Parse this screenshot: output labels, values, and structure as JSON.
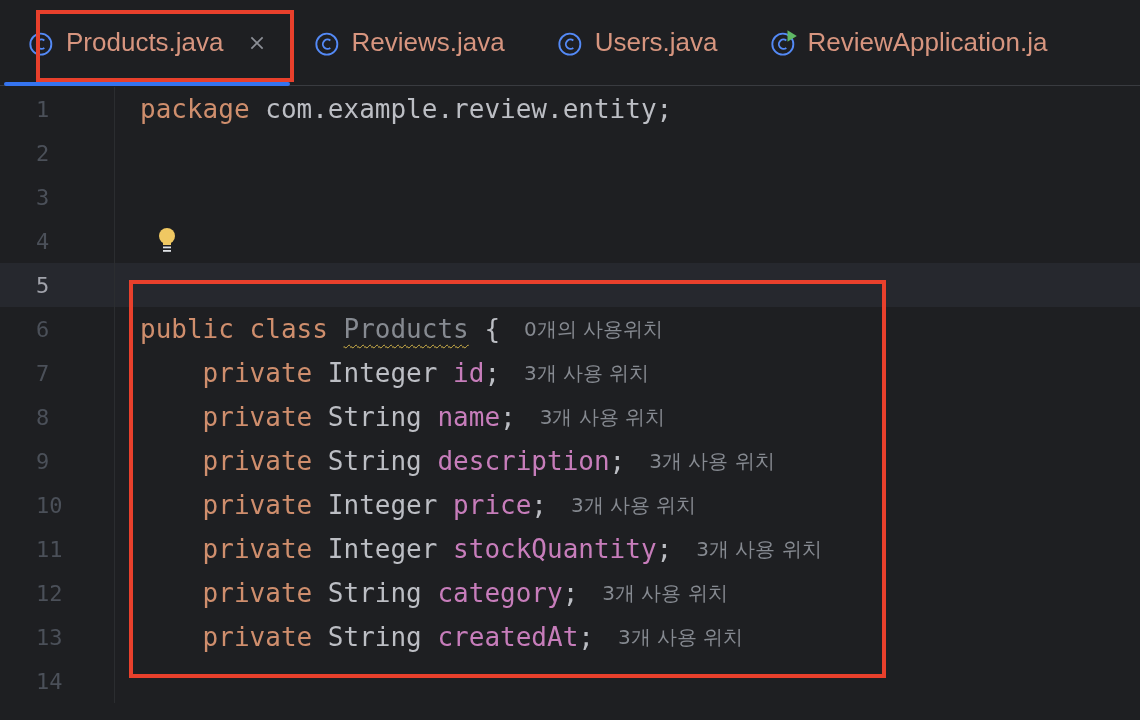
{
  "tabs": [
    {
      "label": "Products.java",
      "kind": "class",
      "selected": true
    },
    {
      "label": "Reviews.java",
      "kind": "class",
      "selected": false
    },
    {
      "label": "Users.java",
      "kind": "class",
      "selected": false
    },
    {
      "label": "ReviewApplication.ja",
      "kind": "app",
      "selected": false
    }
  ],
  "lines": [
    {
      "number": "1",
      "current": false,
      "bulb": false,
      "tokens": [
        {
          "kind": "keyword",
          "text": "package"
        },
        {
          "kind": "plain",
          "text": " com.example.review.entity;"
        }
      ]
    },
    {
      "number": "2",
      "current": false,
      "bulb": false
    },
    {
      "number": "3",
      "current": false,
      "bulb": false
    },
    {
      "number": "4",
      "current": false,
      "bulb": true
    },
    {
      "number": "5",
      "current": true,
      "bulb": false
    },
    {
      "number": "6",
      "current": false,
      "bulb": false,
      "tokens": [
        {
          "kind": "keyword",
          "text": "public class "
        },
        {
          "kind": "unused",
          "text": "Products"
        },
        {
          "kind": "plain",
          "text": " {"
        }
      ],
      "hint": "0개의 사용위치"
    },
    {
      "number": "7",
      "current": false,
      "bulb": false,
      "tokens": [
        {
          "kind": "keyword",
          "text": "    private "
        },
        {
          "kind": "plain",
          "text": "Integer "
        },
        {
          "kind": "field",
          "text": "id"
        },
        {
          "kind": "plain",
          "text": ";"
        }
      ],
      "hint": "3개 사용 위치"
    },
    {
      "number": "8",
      "current": false,
      "bulb": false,
      "tokens": [
        {
          "kind": "keyword",
          "text": "    private "
        },
        {
          "kind": "plain",
          "text": "String "
        },
        {
          "kind": "field",
          "text": "name"
        },
        {
          "kind": "plain",
          "text": ";"
        }
      ],
      "hint": "3개 사용 위치"
    },
    {
      "number": "9",
      "current": false,
      "bulb": false,
      "tokens": [
        {
          "kind": "keyword",
          "text": "    private "
        },
        {
          "kind": "plain",
          "text": "String "
        },
        {
          "kind": "field",
          "text": "description"
        },
        {
          "kind": "plain",
          "text": ";"
        }
      ],
      "hint": "3개 사용 위치"
    },
    {
      "number": "10",
      "current": false,
      "bulb": false,
      "tokens": [
        {
          "kind": "keyword",
          "text": "    private "
        },
        {
          "kind": "plain",
          "text": "Integer "
        },
        {
          "kind": "field",
          "text": "price"
        },
        {
          "kind": "plain",
          "text": ";"
        }
      ],
      "hint": "3개 사용 위치"
    },
    {
      "number": "11",
      "current": false,
      "bulb": false,
      "tokens": [
        {
          "kind": "keyword",
          "text": "    private "
        },
        {
          "kind": "plain",
          "text": "Integer "
        },
        {
          "kind": "field",
          "text": "stockQuantity"
        },
        {
          "kind": "plain",
          "text": ";"
        }
      ],
      "hint": "3개 사용 위치"
    },
    {
      "number": "12",
      "current": false,
      "bulb": false,
      "tokens": [
        {
          "kind": "keyword",
          "text": "    private "
        },
        {
          "kind": "plain",
          "text": "String "
        },
        {
          "kind": "field",
          "text": "category"
        },
        {
          "kind": "plain",
          "text": ";"
        }
      ],
      "hint": "3개 사용 위치"
    },
    {
      "number": "13",
      "current": false,
      "bulb": false,
      "tokens": [
        {
          "kind": "keyword",
          "text": "    private "
        },
        {
          "kind": "plain",
          "text": "String "
        },
        {
          "kind": "field",
          "text": "createdAt"
        },
        {
          "kind": "plain",
          "text": ";"
        }
      ],
      "hint": "3개 사용 위치"
    },
    {
      "number": "14",
      "current": false,
      "bulb": false
    }
  ]
}
